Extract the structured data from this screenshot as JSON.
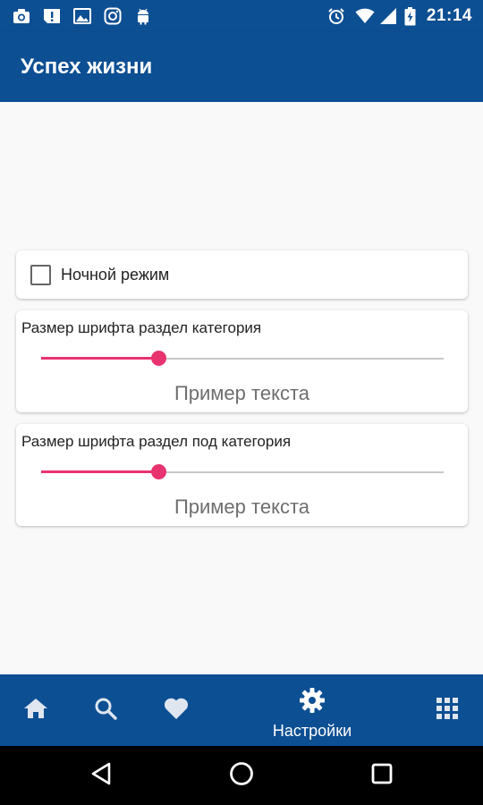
{
  "status_bar": {
    "time": "21:14",
    "left_icons": [
      "camera-icon",
      "alert-icon",
      "image-icon",
      "instagram-icon",
      "android-icon"
    ],
    "right_icons": [
      "alarm-icon",
      "wifi-icon",
      "signal-icon",
      "battery-charging-icon"
    ]
  },
  "app_bar": {
    "title": "Успех жизни",
    "color": "#0d4f93"
  },
  "settings": {
    "night_mode": {
      "label": "Ночной режим",
      "checked": false
    },
    "font_category": {
      "label": "Размер шрифта раздел категория",
      "sample": "Пример текста",
      "value_fraction": 0.29
    },
    "font_subcategory": {
      "label": "Размер шрифта раздел под категория",
      "sample": "Пример текста",
      "value_fraction": 0.29
    },
    "accent_color": "#e8336f"
  },
  "bottom_nav": {
    "items": [
      {
        "icon": "home-icon"
      },
      {
        "icon": "search-icon"
      },
      {
        "icon": "heart-icon"
      },
      {
        "icon": "gear-icon",
        "label": "Настройки",
        "active": true
      },
      {
        "icon": "grid-icon"
      }
    ]
  },
  "system_nav": {
    "buttons": [
      "back-icon",
      "home-circle-icon",
      "recents-icon"
    ]
  }
}
